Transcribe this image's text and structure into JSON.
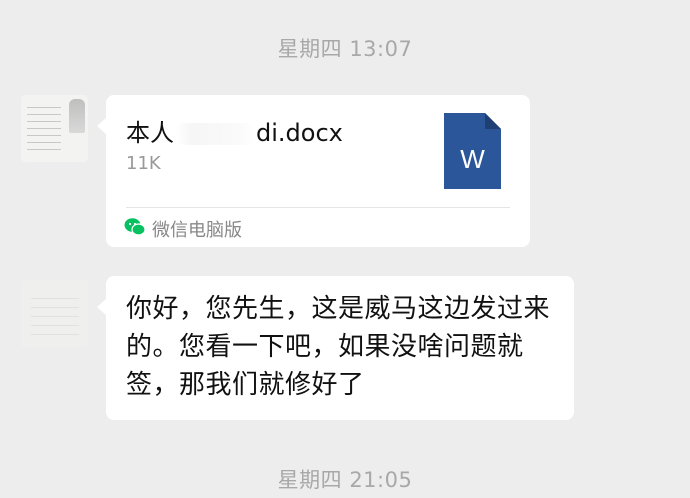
{
  "messages": {
    "timestamp_top": "星期四 13:07",
    "file_card": {
      "file_name_prefix": "本人",
      "file_name_suffix": "di.docx",
      "file_size": "11K",
      "file_icon_letter": "W",
      "source_label": "微信电脑版"
    },
    "text_message": "你好，您先生，这是威马这边发过来的。您看一下吧，如果没啥问题就签，那我们就修好了",
    "timestamp_bottom": "星期四 21:05"
  },
  "colors": {
    "background": "#ededed",
    "bubble": "#ffffff",
    "word_icon": "#2b579a",
    "wechat_green": "#07c160"
  }
}
